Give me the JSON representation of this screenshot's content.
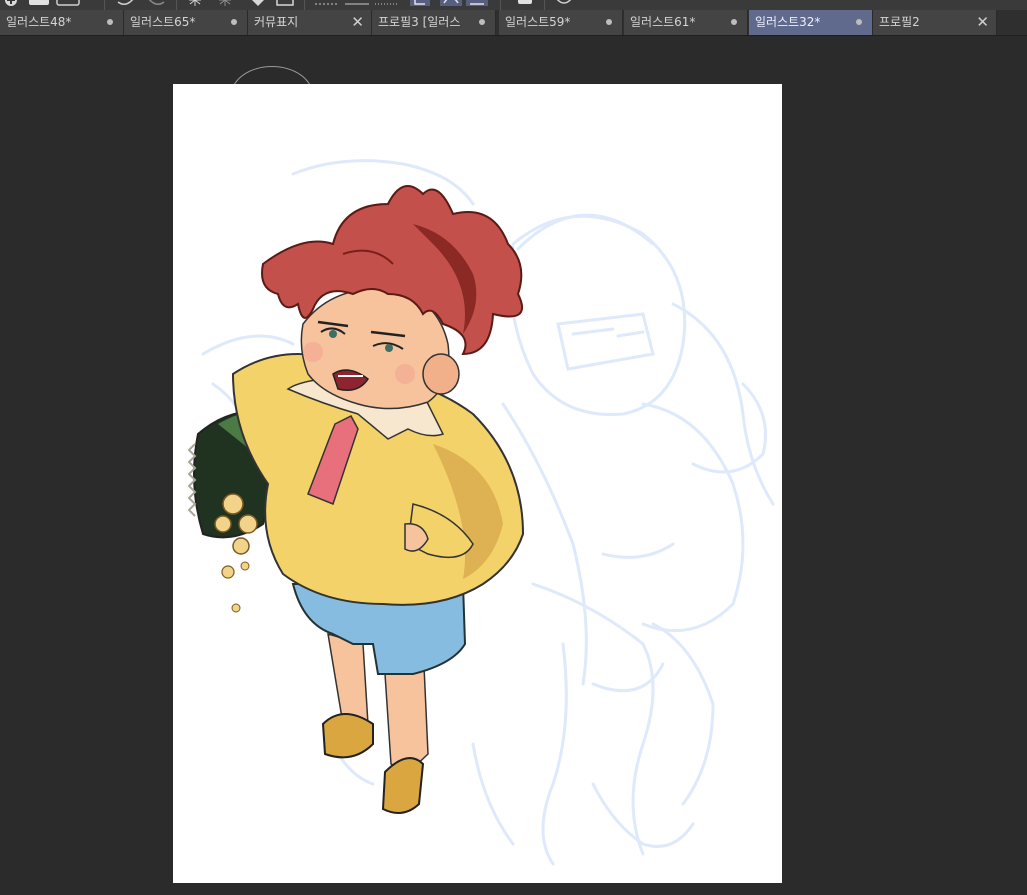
{
  "tabs": [
    {
      "label": "일러스트48*",
      "indicator": "dot"
    },
    {
      "label": "일러스트65*",
      "indicator": "dot"
    },
    {
      "label": "커뮤표지",
      "indicator": "close"
    },
    {
      "label": "프로필3 [일러스",
      "indicator": "dot"
    },
    {
      "label": "일러스트59*",
      "indicator": "dot"
    },
    {
      "label": "일러스트61*",
      "indicator": "dot"
    },
    {
      "label": "일러스트32*",
      "indicator": "dot",
      "active": true
    },
    {
      "label": "프로필2",
      "indicator": "close"
    }
  ],
  "colors": {
    "app_background": "#2b2b2b",
    "tab_background": "#444444",
    "tab_active": "#5f6a8c",
    "canvas": "#ffffff",
    "sketch_lines": "#dde8fb",
    "hair": "#c3504a",
    "sweater": "#f4d26a",
    "shorts": "#86bcdf",
    "tie": "#e8707d",
    "shoes": "#d9a640",
    "chip_bag": "#3d5a3a"
  },
  "icons": {
    "toolbar": [
      "add-layer-icon",
      "layer-icon",
      "folder-icon",
      "undo-icon",
      "redo-icon",
      "transform-icon",
      "sparkle-icon",
      "fill-icon",
      "select-icon",
      "ruler-icon",
      "grid-icon",
      "lasso-icon",
      "clear-icon",
      "chat-icon"
    ],
    "tab_close": "close-icon",
    "tab_modified": "modified-dot-icon",
    "cursor": "brush-cursor-icon"
  }
}
